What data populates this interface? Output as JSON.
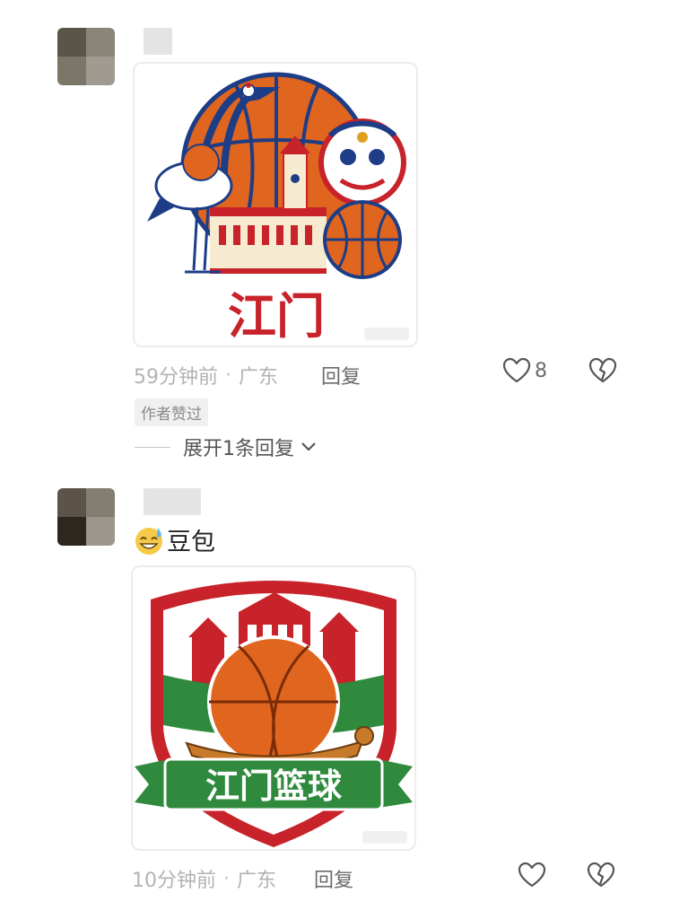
{
  "comments": [
    {
      "image": {
        "logo_text": "江门"
      },
      "meta": {
        "time": "59分钟前",
        "separator": "·",
        "location": "广东",
        "reply_label": "回复",
        "like_count": "8"
      },
      "badge": "作者赞过",
      "expand": {
        "label": "展开1条回复"
      }
    },
    {
      "text": "豆包",
      "image": {
        "logo_text": "江门篮球"
      },
      "meta": {
        "time": "10分钟前",
        "separator": "·",
        "location": "广东",
        "reply_label": "回复",
        "like_count": ""
      }
    }
  ],
  "icons": {
    "like": "heart-outline-icon",
    "dislike": "broken-heart-icon",
    "expand": "chevron-down-icon",
    "emoji": "grinning-sweat-emoji"
  },
  "colors": {
    "orange": "#e0651f",
    "navy": "#1d3d86",
    "red": "#c8222a",
    "green": "#2f8a3d",
    "cream": "#f6ead0"
  }
}
